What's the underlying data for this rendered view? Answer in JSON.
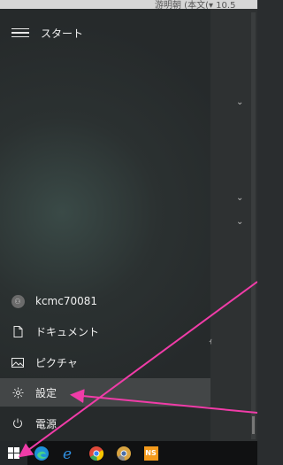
{
  "top_doc": {
    "left_text": "",
    "right_text": "游明朝 (本文(▾ 10.5"
  },
  "menu": {
    "title": "スタート"
  },
  "user": {
    "name": "kcmc70081"
  },
  "nav": [
    {
      "label": "ドキュメント",
      "icon": "document-icon"
    },
    {
      "label": "ピクチャ",
      "icon": "pictures-icon"
    },
    {
      "label": "設定",
      "icon": "gear-icon"
    },
    {
      "label": "電源",
      "icon": "power-icon"
    }
  ],
  "right_panel": {
    "chevron": "⌄",
    "stray_char": "ｨ"
  },
  "taskbar": {
    "items": [
      "start-button",
      "edge-new",
      "edge-legacy",
      "chrome",
      "chrome-dev",
      "ns-app"
    ],
    "ns_label": "NS"
  },
  "colors": {
    "annotation": "#f03ca8",
    "edge_blue": "#1e90d8",
    "chrome_red": "#e04a3b",
    "ns_orange": "#f39a1c"
  }
}
